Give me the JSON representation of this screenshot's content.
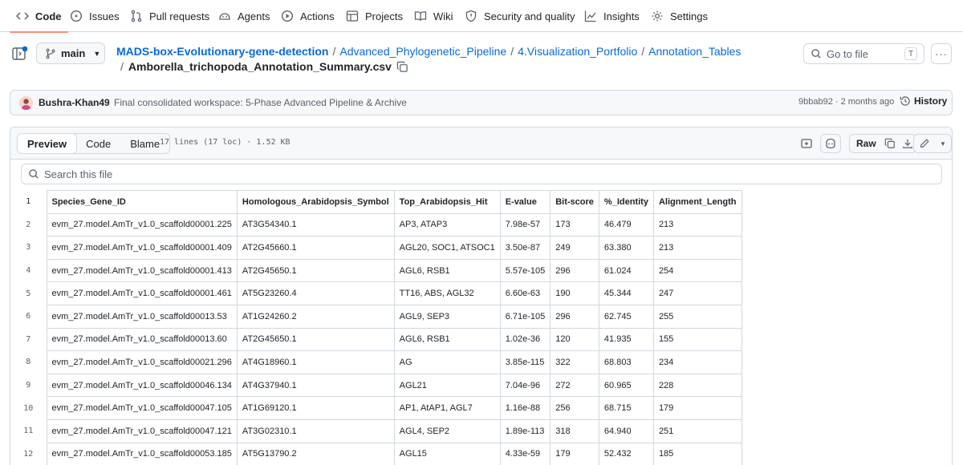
{
  "nav": {
    "tabs": [
      "Code",
      "Issues",
      "Pull requests",
      "Agents",
      "Actions",
      "Projects",
      "Wiki",
      "Security and quality",
      "Insights",
      "Settings"
    ]
  },
  "branch": "main",
  "breadcrumb": {
    "repo": "MADS-box-Evolutionary-gene-detection",
    "dirs": [
      "Advanced_Phylogenetic_Pipeline",
      "4.Visualization_Portfolio",
      "Annotation_Tables"
    ],
    "file": "Amborella_trichopoda_Annotation_Summary.csv",
    "sep": "/"
  },
  "goto": {
    "placeholder": "Go to file",
    "key": "T"
  },
  "commit": {
    "author": "Bushra-Khan49",
    "message": "Final consolidated workspace: 5-Phase Advanced Pipeline & Archive",
    "sha_time": "9bbab92 · 2 months ago",
    "history": "History"
  },
  "file": {
    "views": [
      "Preview",
      "Code",
      "Blame"
    ],
    "meta": "17 lines (17 loc) · 1.52 KB",
    "raw": "Raw",
    "search_placeholder": "Search this file"
  },
  "table": {
    "columns": [
      "Species_Gene_ID",
      "Homologous_Arabidopsis_Symbol",
      "Top_Arabidopsis_Hit",
      "E-value",
      "Bit-score",
      "%_Identity",
      "Alignment_Length"
    ],
    "rows": [
      [
        "evm_27.model.AmTr_v1.0_scaffold00001.225",
        "AT3G54340.1",
        "AP3, ATAP3",
        "7.98e-57",
        "173",
        "46.479",
        "213"
      ],
      [
        "evm_27.model.AmTr_v1.0_scaffold00001.409",
        "AT2G45660.1",
        "AGL20, SOC1, ATSOC1",
        "3.50e-87",
        "249",
        "63.380",
        "213"
      ],
      [
        "evm_27.model.AmTr_v1.0_scaffold00001.413",
        "AT2G45650.1",
        "AGL6, RSB1",
        "5.57e-105",
        "296",
        "61.024",
        "254"
      ],
      [
        "evm_27.model.AmTr_v1.0_scaffold00001.461",
        "AT5G23260.4",
        "TT16, ABS, AGL32",
        "6.60e-63",
        "190",
        "45.344",
        "247"
      ],
      [
        "evm_27.model.AmTr_v1.0_scaffold00013.53",
        "AT1G24260.2",
        "AGL9, SEP3",
        "6.71e-105",
        "296",
        "62.745",
        "255"
      ],
      [
        "evm_27.model.AmTr_v1.0_scaffold00013.60",
        "AT2G45650.1",
        "AGL6, RSB1",
        "1.02e-36",
        "120",
        "41.935",
        "155"
      ],
      [
        "evm_27.model.AmTr_v1.0_scaffold00021.296",
        "AT4G18960.1",
        "AG",
        "3.85e-115",
        "322",
        "68.803",
        "234"
      ],
      [
        "evm_27.model.AmTr_v1.0_scaffold00046.134",
        "AT4G37940.1",
        "AGL21",
        "7.04e-96",
        "272",
        "60.965",
        "228"
      ],
      [
        "evm_27.model.AmTr_v1.0_scaffold00047.105",
        "AT1G69120.1",
        "AP1, AtAP1, AGL7",
        "1.16e-88",
        "256",
        "68.715",
        "179"
      ],
      [
        "evm_27.model.AmTr_v1.0_scaffold00047.121",
        "AT3G02310.1",
        "AGL4, SEP2",
        "1.89e-113",
        "318",
        "64.940",
        "251"
      ],
      [
        "evm_27.model.AmTr_v1.0_scaffold00053.185",
        "AT5G13790.2",
        "AGL15",
        "4.33e-59",
        "179",
        "52.432",
        "185"
      ]
    ]
  }
}
